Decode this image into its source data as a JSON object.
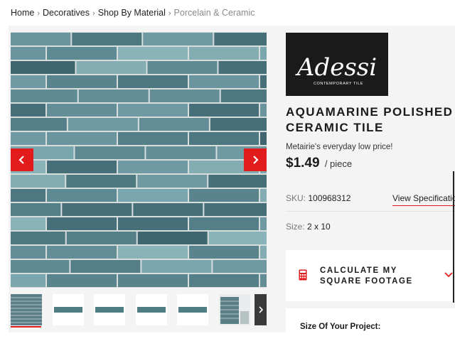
{
  "breadcrumb": {
    "items": [
      "Home",
      "Decoratives",
      "Shop By Material"
    ],
    "current": "Porcelain & Ceramic",
    "separator": "›"
  },
  "gallery": {
    "prev_icon": "chevron-left-icon",
    "next_icon": "chevron-right-icon",
    "thumbnail_count": 6,
    "active_thumbnail": 1
  },
  "brand": {
    "logo_text": "Adessi",
    "logo_subtext": "CONTEMPORARY TILE"
  },
  "product": {
    "title": "AQUAMARINE POLISHED CERAMIC TILE",
    "low_price_text": "Metairie's everyday low price!",
    "price": "$1.49",
    "unit": "/ piece",
    "sku_label": "SKU:",
    "sku_value": "100968312",
    "view_spec_label": "View Specifications",
    "size_label": "Size:",
    "size_value": "2 x 10"
  },
  "calculator": {
    "label": "CALCULATE MY SQUARE FOOTAGE",
    "icon": "calculator-icon",
    "chevron_icon": "chevron-down-icon"
  },
  "project": {
    "label": "Size Of Your Project:"
  },
  "colors": {
    "accent": "#e21c1c",
    "tile_base": "#5b7f87",
    "logo_bg": "#1a1a1a"
  }
}
